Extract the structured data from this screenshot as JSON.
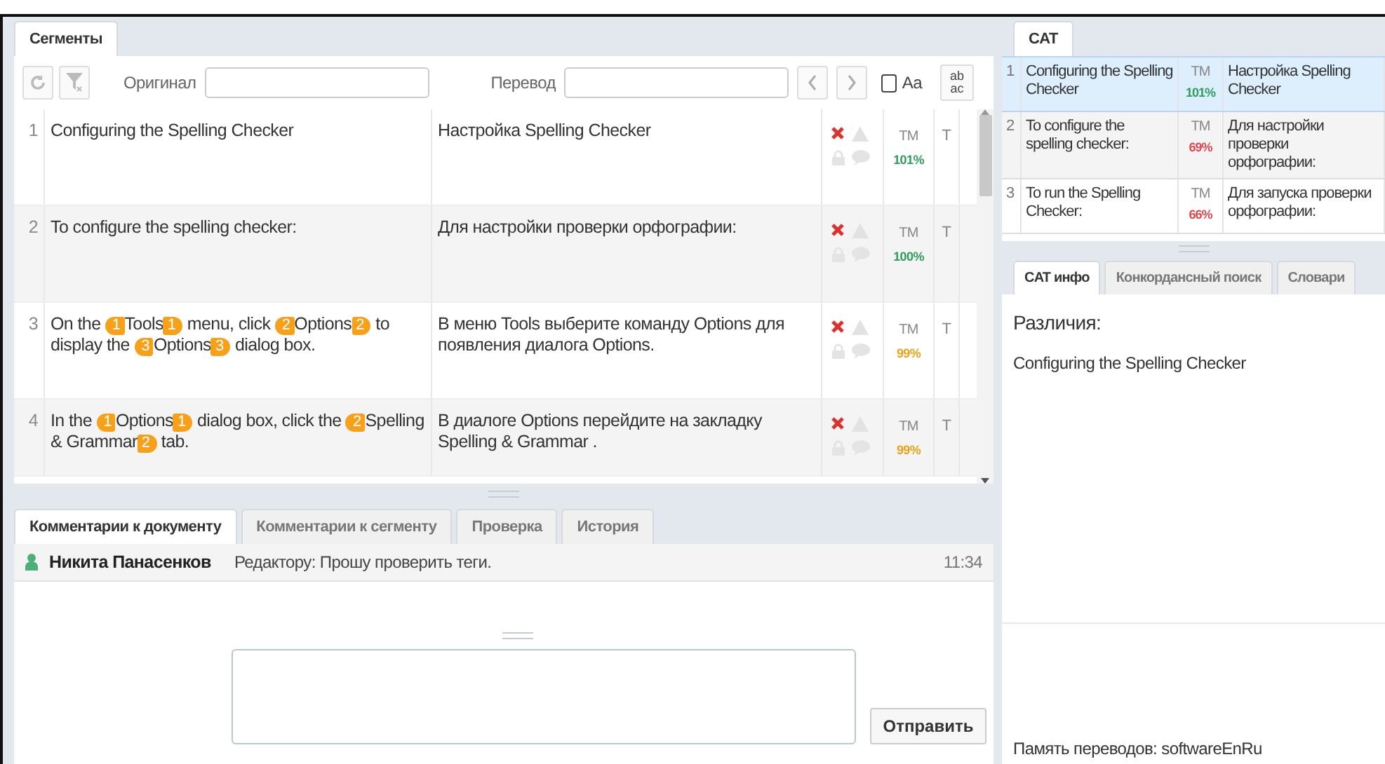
{
  "segments_panel": {
    "tabs": [
      {
        "label": "Сегменты",
        "selected": true
      }
    ],
    "filter": {
      "source_label": "Оригинал",
      "target_label": "Перевод",
      "case_label": "Aa",
      "case_checked": false,
      "replace_top": "ab",
      "replace_bottom": "ac"
    },
    "rows": [
      {
        "number": "1",
        "source": [
          {
            "kind": "text",
            "text": "Configuring the Spelling Checker"
          }
        ],
        "target": "Настройка Spelling Checker",
        "tm": "TM",
        "match": "101%",
        "color": "#2e9e5b",
        "type": "T"
      },
      {
        "number": "2",
        "source": [
          {
            "kind": "text",
            "text": "To configure the spelling checker:"
          }
        ],
        "target": "Для настройки проверки орфографии:",
        "tm": "TM",
        "match": "100%",
        "color": "#2e9e5b",
        "type": "T"
      },
      {
        "number": "3",
        "source": [
          {
            "kind": "text",
            "text": "On the "
          },
          {
            "kind": "open",
            "text": "1"
          },
          {
            "kind": "text",
            "text": "Tools"
          },
          {
            "kind": "close",
            "text": "1"
          },
          {
            "kind": "text",
            "text": " menu, click "
          },
          {
            "kind": "open",
            "text": "2"
          },
          {
            "kind": "text",
            "text": "Options"
          },
          {
            "kind": "close",
            "text": "2"
          },
          {
            "kind": "text",
            "text": " to display the "
          },
          {
            "kind": "open",
            "text": "3"
          },
          {
            "kind": "text",
            "text": "Options"
          },
          {
            "kind": "close",
            "text": "3"
          },
          {
            "kind": "text",
            "text": " dialog box."
          }
        ],
        "target": "В меню Tools выберите команду Options для появления диалога Options.",
        "tm": "TM",
        "match": "99%",
        "color": "#e8a317",
        "type": "T"
      },
      {
        "number": "4",
        "source": [
          {
            "kind": "text",
            "text": "In the "
          },
          {
            "kind": "open",
            "text": "1"
          },
          {
            "kind": "text",
            "text": "Options"
          },
          {
            "kind": "close",
            "text": "1"
          },
          {
            "kind": "text",
            "text": " dialog box, click the "
          },
          {
            "kind": "open",
            "text": "2"
          },
          {
            "kind": "text",
            "text": "Spelling & Grammar"
          },
          {
            "kind": "close",
            "text": "2"
          },
          {
            "kind": "text",
            "text": " tab."
          }
        ],
        "target": "В диалоге Options перейдите на закладку Spelling & Grammar .",
        "tm": "TM",
        "match": "99%",
        "color": "#e8a317",
        "type": "T"
      }
    ]
  },
  "comments_panel": {
    "tabs": [
      {
        "label": "Комментарии к документу",
        "selected": true
      },
      {
        "label": "Комментарии к сегменту",
        "selected": false
      },
      {
        "label": "Проверка",
        "selected": false
      },
      {
        "label": "История",
        "selected": false
      }
    ],
    "comments": [
      {
        "author": "Никита Панасенков",
        "text": "Редактору: Прошу проверить теги.",
        "time": "11:34"
      }
    ],
    "send_button": "Отправить"
  },
  "cat_panel": {
    "tabs": [
      {
        "label": "CAT",
        "selected": true
      }
    ],
    "rows": [
      {
        "number": "1",
        "source": "Configuring the Spelling Checker",
        "tm": "TM",
        "match": "101%",
        "color": "#2e9e5b",
        "target": "Настройка Spelling Checker",
        "selected": true
      },
      {
        "number": "2",
        "source": "To configure the spelling checker:",
        "tm": "TM",
        "match": "69%",
        "color": "#e0474c",
        "target": "Для настройки проверки орфографии:",
        "selected": false
      },
      {
        "number": "3",
        "source": "To run the Spelling Checker:",
        "tm": "TM",
        "match": "66%",
        "color": "#e0474c",
        "target": "Для запуска проверки орфографии:",
        "selected": false
      }
    ]
  },
  "info_panel": {
    "tabs": [
      {
        "label": "CAT инфо",
        "selected": true
      },
      {
        "label": "Конкордансный поиск",
        "selected": false
      },
      {
        "label": "Словари",
        "selected": false
      }
    ],
    "heading": "Различия:",
    "text": "Configuring the Spelling Checker",
    "footer": "Память переводов: softwareEnRu"
  }
}
